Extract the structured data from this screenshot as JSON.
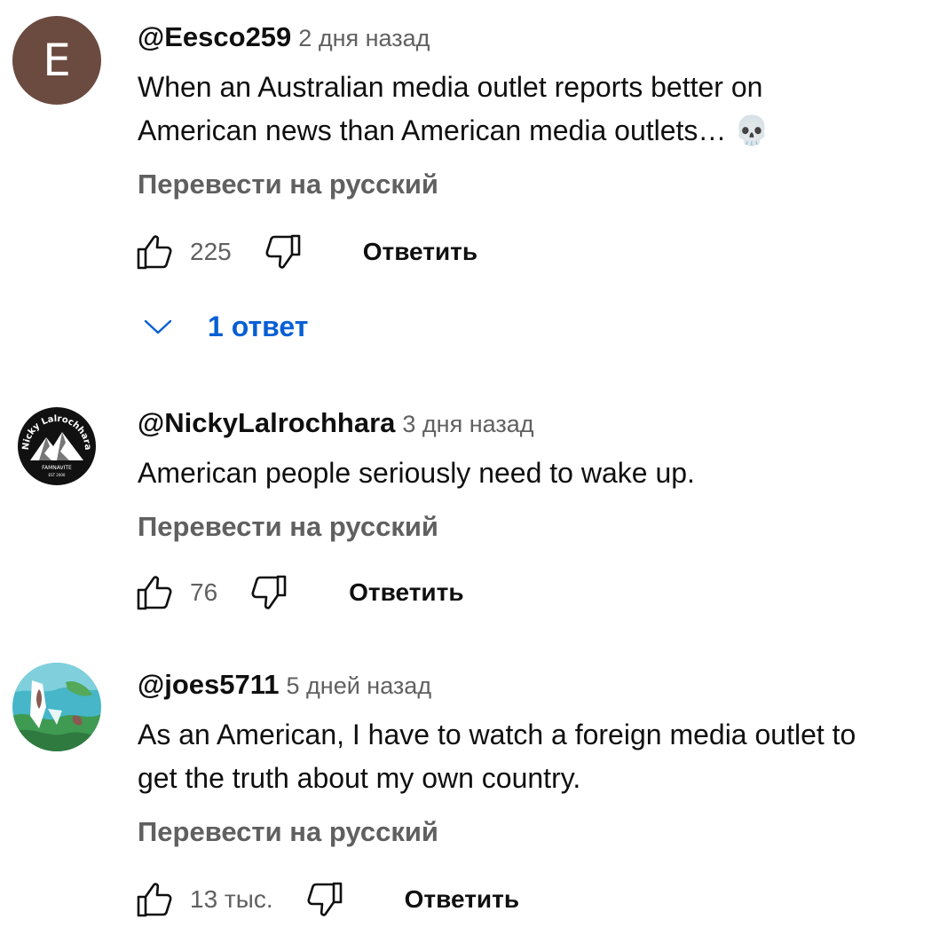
{
  "comments": [
    {
      "author": "@Eesco259",
      "time": "2 дня назад",
      "avatar_letter": "E",
      "text_line1": "When an Australian media outlet reports better on",
      "text_line2": "American news than American media outlets… 💀",
      "translate_label": "Перевести на русский",
      "likes": "225",
      "reply_label": "Ответить",
      "replies_label": "1 ответ"
    },
    {
      "author": "@NickyLalrochhara",
      "time": "3 дня назад",
      "avatar_text_top": "Nicky Lalrochhara",
      "avatar_text_bottom": "FAMNAVITE",
      "avatar_est": "EST 2000",
      "text_line1": "American people seriously need to wake up.",
      "translate_label": "Перевести на русский",
      "likes": "76",
      "reply_label": "Ответить"
    },
    {
      "author": "@joes5711",
      "time": "5 дней назад",
      "text_line1": "As an American, I have to watch a foreign media outlet to",
      "text_line2": "get the truth about my own country.",
      "translate_label": "Перевести на русский",
      "likes": "13 тыс.",
      "reply_label": "Ответить"
    }
  ],
  "icons": {
    "like": "thumb-up-icon",
    "dislike": "thumb-down-icon",
    "expand": "chevron-down-icon"
  },
  "colors": {
    "text": "#0f0f0f",
    "secondary": "#606060",
    "link": "#065fd4",
    "avatar_e": "#6b4a40"
  }
}
